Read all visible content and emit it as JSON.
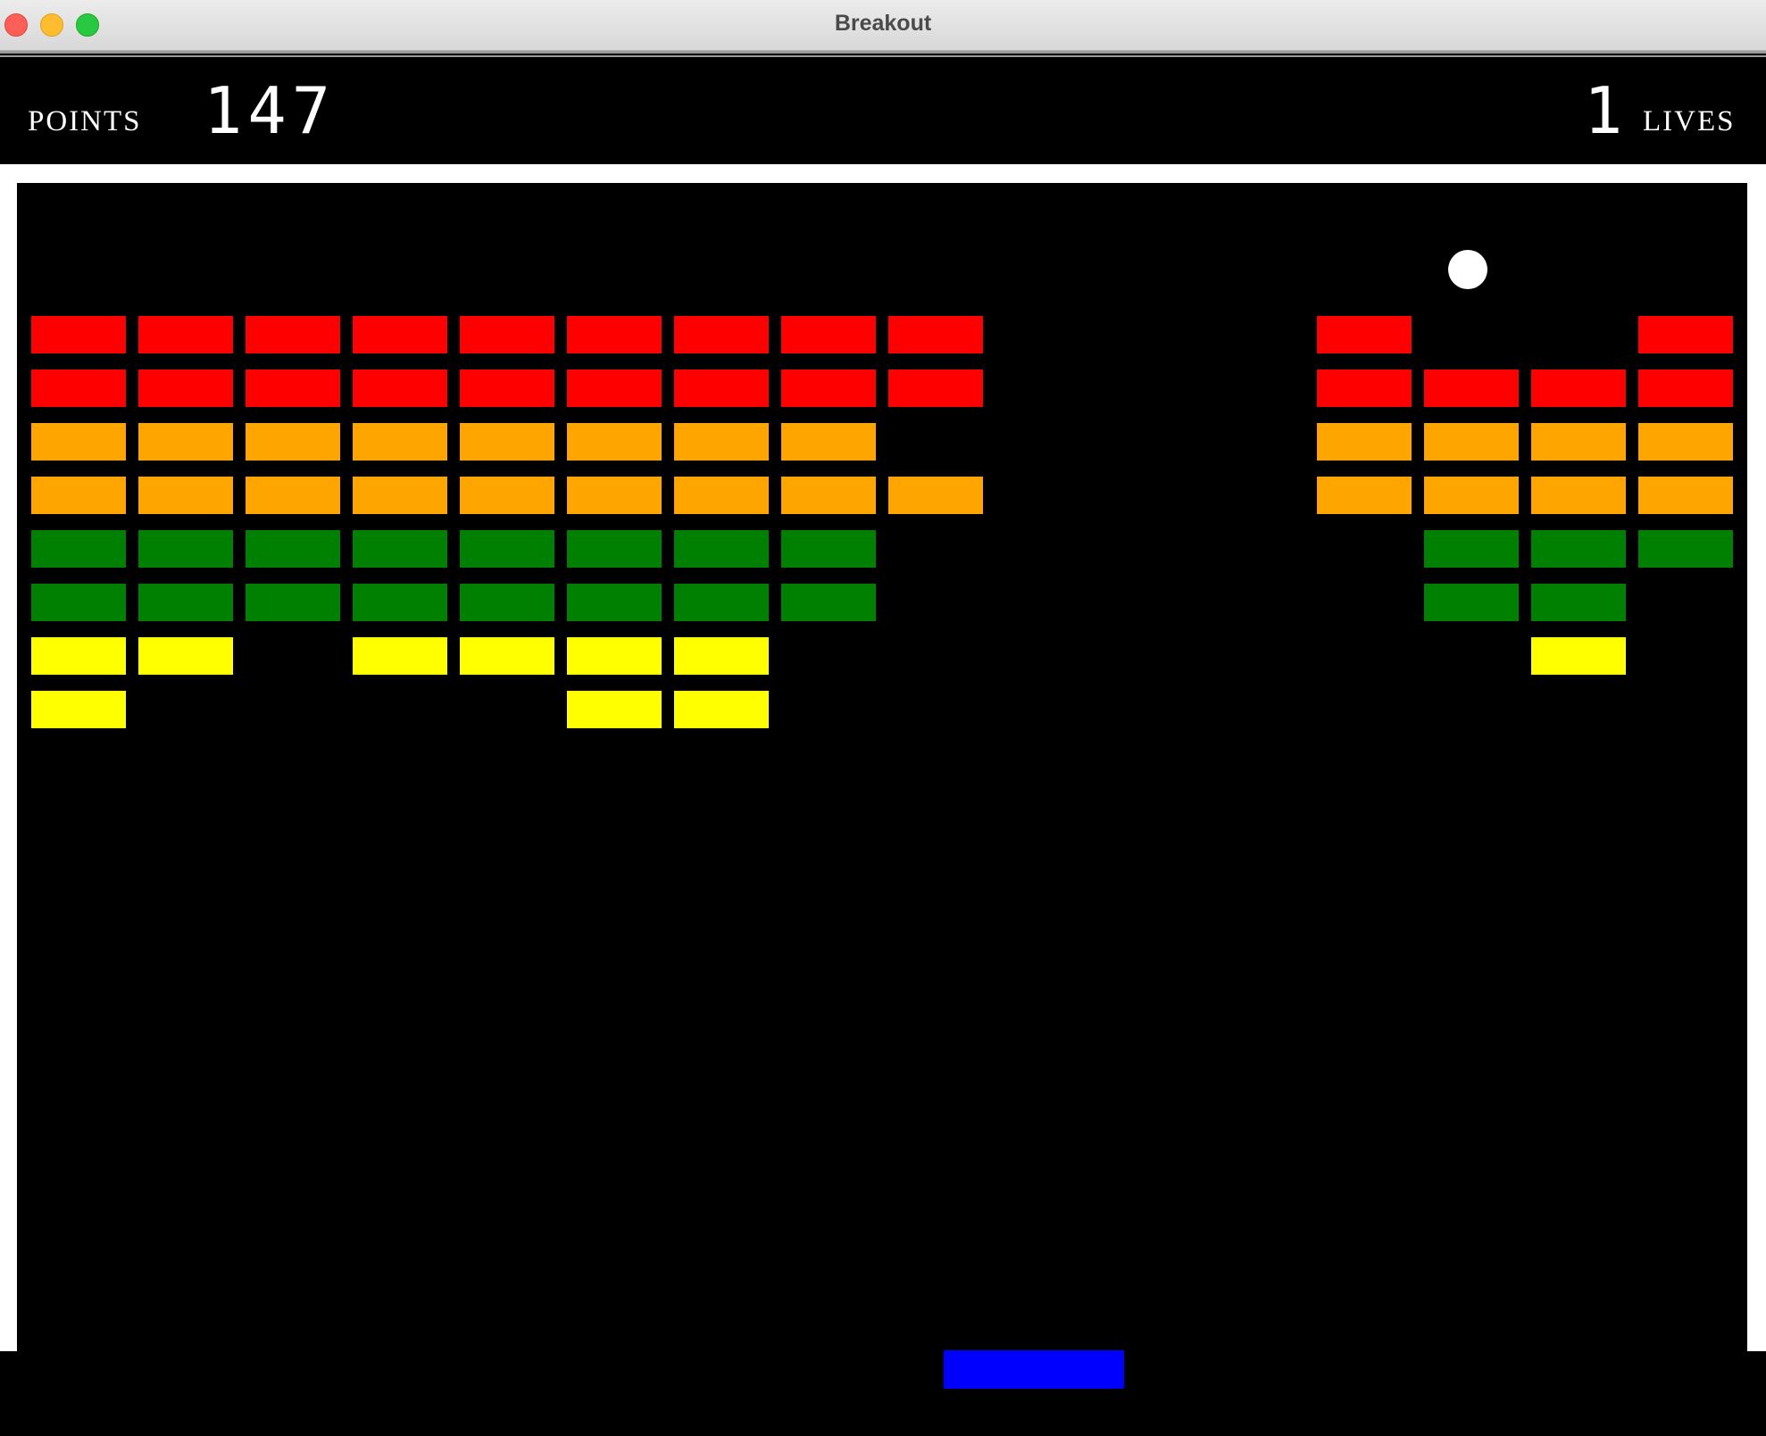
{
  "window": {
    "title": "Breakout"
  },
  "hud": {
    "points_label": "POINTS",
    "points": "147",
    "lives": "1",
    "lives_label": "LIVES"
  },
  "colors": {
    "red": "#ff0000",
    "orange": "#ffa500",
    "green": "#008000",
    "yellow": "#ffff00",
    "paddle": "#0000ff",
    "ball": "#ffffff",
    "wall": "#ffffff"
  },
  "board": {
    "columns": 16,
    "rows": [
      {
        "color": "red",
        "present": [
          1,
          1,
          1,
          1,
          1,
          1,
          1,
          1,
          1,
          0,
          0,
          0,
          1,
          0,
          0,
          1
        ]
      },
      {
        "color": "red",
        "present": [
          1,
          1,
          1,
          1,
          1,
          1,
          1,
          1,
          1,
          0,
          0,
          0,
          1,
          1,
          1,
          1
        ]
      },
      {
        "color": "orange",
        "present": [
          1,
          1,
          1,
          1,
          1,
          1,
          1,
          1,
          0,
          0,
          0,
          0,
          1,
          1,
          1,
          1
        ]
      },
      {
        "color": "orange",
        "present": [
          1,
          1,
          1,
          1,
          1,
          1,
          1,
          1,
          1,
          0,
          0,
          0,
          1,
          1,
          1,
          1
        ]
      },
      {
        "color": "green",
        "present": [
          1,
          1,
          1,
          1,
          1,
          1,
          1,
          1,
          0,
          0,
          0,
          0,
          0,
          1,
          1,
          1
        ]
      },
      {
        "color": "green",
        "present": [
          1,
          1,
          1,
          1,
          1,
          1,
          1,
          1,
          0,
          0,
          0,
          0,
          0,
          1,
          1,
          0
        ]
      },
      {
        "color": "yellow",
        "present": [
          1,
          1,
          0,
          1,
          1,
          1,
          1,
          0,
          0,
          0,
          0,
          0,
          0,
          0,
          1,
          0
        ]
      },
      {
        "color": "yellow",
        "present": [
          1,
          0,
          0,
          0,
          0,
          1,
          1,
          0,
          0,
          0,
          0,
          0,
          0,
          0,
          0,
          0
        ]
      }
    ]
  }
}
